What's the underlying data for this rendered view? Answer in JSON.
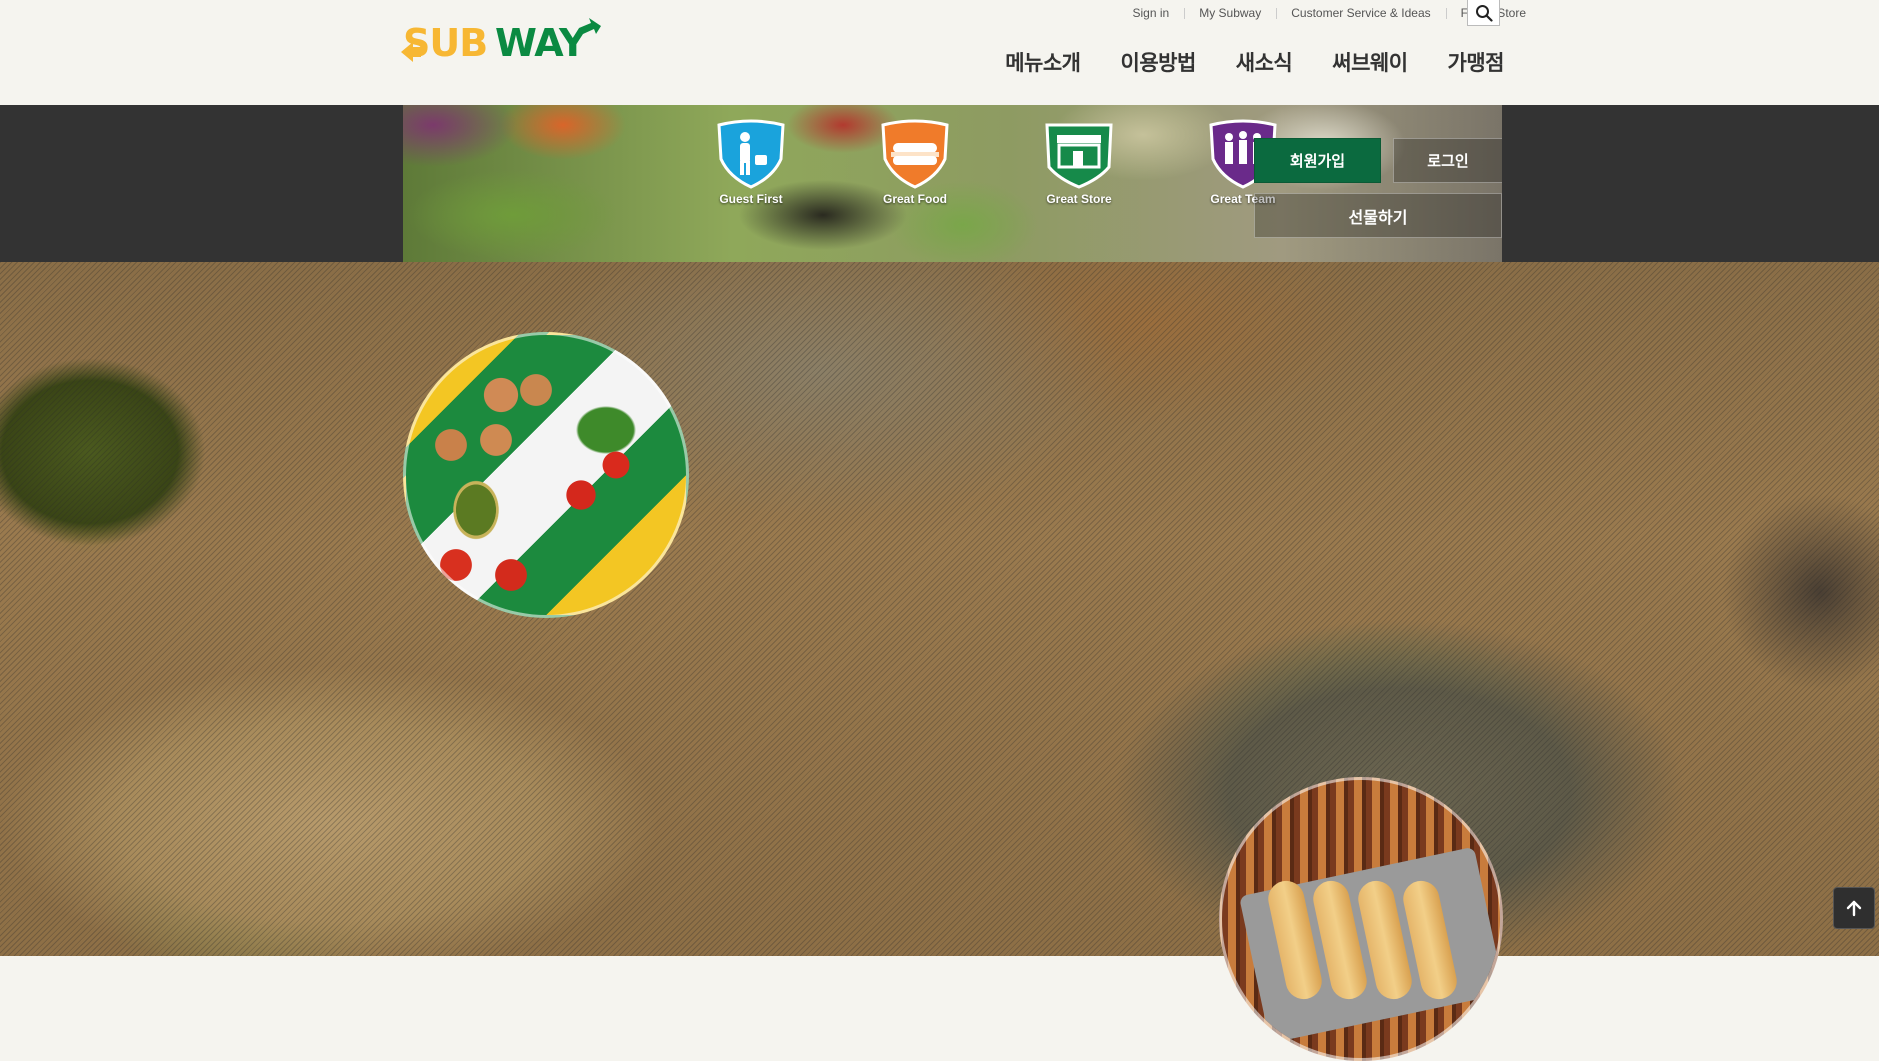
{
  "header": {
    "logo_text": "SUBWAY",
    "util_links": [
      "Sign in",
      "My Subway",
      "Customer Service & Ideas",
      "Find a Store"
    ],
    "search_icon": "search-icon",
    "gnb": [
      "메뉴소개",
      "이용방법",
      "새소식",
      "써브웨이",
      "가맹점"
    ]
  },
  "band": {
    "values": [
      {
        "label": "Guest First",
        "icon": "guest-first-shield-icon",
        "color": "#1aa3dc"
      },
      {
        "label": "Great Food",
        "icon": "great-food-shield-icon",
        "color": "#f07b2a"
      },
      {
        "label": "Great Store",
        "icon": "great-store-shield-icon",
        "color": "#168a4a"
      },
      {
        "label": "Great Team",
        "icon": "great-team-shield-icon",
        "color": "#6a2a8a"
      }
    ],
    "join_label": "회원가입",
    "login_label": "로그인",
    "gift_label": "선물하기"
  },
  "colors": {
    "brand_green": "#0b6a3f",
    "brand_yellow": "#f7b733"
  },
  "top_button_icon": "arrow-up-icon"
}
